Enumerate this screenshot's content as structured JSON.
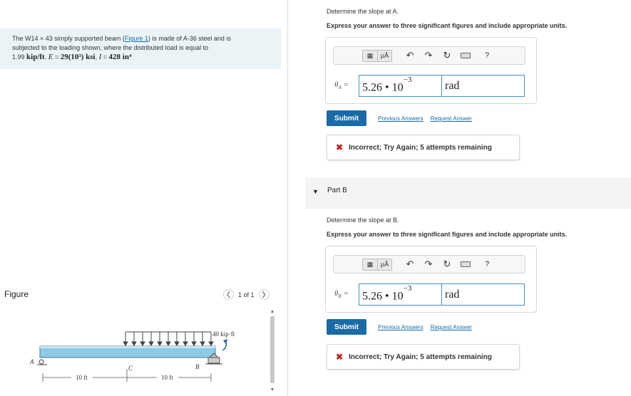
{
  "problem": {
    "text1": "The W14 × 43 simply supported beam (",
    "figure_link": "Figure 1",
    "text2": ") is made of A-36 steel and is",
    "line2": "subjected to the loading shown, where the distributed load is equal to",
    "load_value": "1.99",
    "load_unit": "kip/ft",
    "E_label": "E",
    "E_value": "29(10³) ksi",
    "I_label": "I",
    "I_value": "428 in⁴"
  },
  "figure": {
    "label": "Figure",
    "pager_text": "1 of 1",
    "moment_label": "40 kip·ft",
    "point_A": "A",
    "point_B": "B",
    "point_C": "C",
    "dim_left": "10 ft",
    "dim_right": "10 ft"
  },
  "partA": {
    "prompt": "Determine the slope at A.",
    "instruction": "Express your answer to three significant figures and include appropriate units.",
    "var_symbol": "θ",
    "var_sub": "A",
    "value_mantissa": "5.26 • 10",
    "value_exp": "−3",
    "unit": "rad",
    "submit": "Submit",
    "prev_answers": "Previous Answers",
    "request_answer": "Request Answer",
    "feedback": "Incorrect; Try Again; 5 attempts remaining"
  },
  "partB": {
    "title": "Part B",
    "prompt": "Determine the slope at B.",
    "instruction": "Express your answer to three significant figures and include appropriate units.",
    "var_symbol": "θ",
    "var_sub": "B",
    "value_mantissa": "5.26 • 10",
    "value_exp": "−3",
    "unit": "rad",
    "submit": "Submit",
    "prev_answers": "Previous Answers",
    "request_answer": "Request Answer",
    "feedback": "Incorrect; Try Again; 5 attempts remaining"
  },
  "toolbar": {
    "units_label": "μÅ",
    "help": "?"
  },
  "colors": {
    "accent": "#1a6aa8",
    "error": "#c62828",
    "input_border": "#4b8ec4",
    "beam": "#8ec9e6"
  }
}
